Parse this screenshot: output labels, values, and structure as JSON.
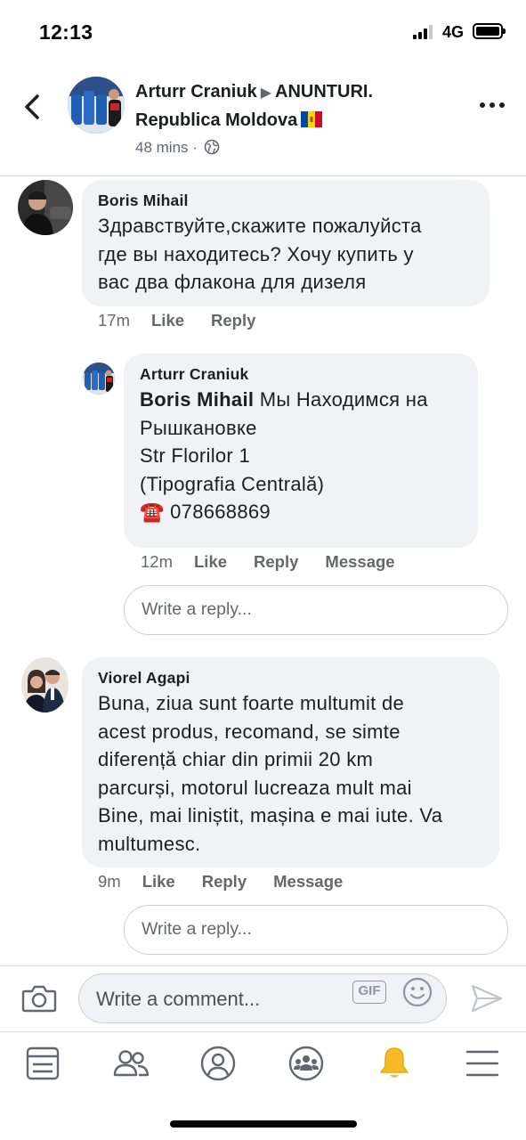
{
  "status_bar": {
    "time": "12:13",
    "network": "4G"
  },
  "post_header": {
    "author": "Arturr Craniuk",
    "separator_icon": "triangle-right-icon",
    "group_line1": "ANUNTURI.",
    "group_line2": "Republica Moldova",
    "flag_icon": "moldova-flag-icon",
    "time": "48 mins",
    "visibility_icon": "globe-icon"
  },
  "comments": [
    {
      "author": "Boris Mihail",
      "lines": [
        "Здравствуйте,скажите пожалуйста",
        "где вы находитесь? Хочу купить у",
        "вас два флакона для дизеля"
      ],
      "time": "17m",
      "actions": [
        "Like",
        "Reply"
      ]
    },
    {
      "author": "Viorel Agapi",
      "lines": [
        "Buna, ziua sunt foarte multumit de",
        "acest produs, recomand, se simte",
        "diferență chiar din primii 20 km",
        "parcurși, motorul lucreaza mult mai",
        "Bine, mai liniștit, mașina e mai iute. Va",
        "multumesc."
      ],
      "time": "9m",
      "actions": [
        "Like",
        "Reply",
        "Message"
      ]
    }
  ],
  "reply": {
    "author": "Arturr Craniuk",
    "mention": "Boris Mihail",
    "line1_rest": " Мы Находимся на",
    "lines": [
      "Рышкановке",
      "Str Florilor 1",
      "(Tipografia Centrală)"
    ],
    "phone_emoji": "☎️",
    "phone": "078668869",
    "time": "12m",
    "actions": [
      "Like",
      "Reply",
      "Message"
    ]
  },
  "reply_placeholder": "Write a reply...",
  "composer": {
    "placeholder": "Write a comment...",
    "gif_label": "GIF"
  },
  "bottom_nav": [
    "news-feed-icon",
    "friends-icon",
    "profile-icon",
    "groups-icon",
    "notifications-bell-icon",
    "menu-icon"
  ],
  "colors": {
    "bubble": "#f0f2f5",
    "secondary_text": "#65676b",
    "bell_active": "#f7b928"
  }
}
